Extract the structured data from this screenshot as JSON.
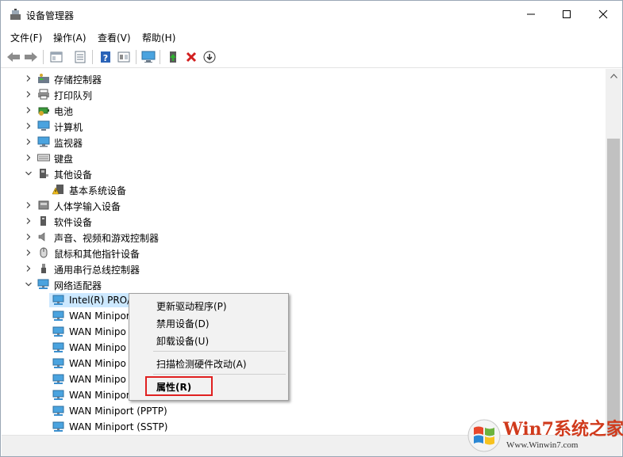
{
  "window": {
    "title": "设备管理器"
  },
  "menu": [
    "文件(F)",
    "操作(A)",
    "查看(V)",
    "帮助(H)"
  ],
  "toolbar": [
    "back-arrow-icon",
    "forward-arrow-icon",
    "properties-icon",
    "list-view-icon",
    "help-icon",
    "resources-icon",
    "monitor-scan-icon",
    "add-driver-icon",
    "delete-x-icon",
    "download-circle-icon"
  ],
  "tree": [
    {
      "label": "存储控制器",
      "indent": 0,
      "exp": "closed",
      "icon": "storage-controller-icon"
    },
    {
      "label": "打印队列",
      "indent": 0,
      "exp": "closed",
      "icon": "printer-icon"
    },
    {
      "label": "电池",
      "indent": 0,
      "exp": "closed",
      "icon": "battery-icon"
    },
    {
      "label": "计算机",
      "indent": 0,
      "exp": "closed",
      "icon": "computer-icon"
    },
    {
      "label": "监视器",
      "indent": 0,
      "exp": "closed",
      "icon": "monitor-icon"
    },
    {
      "label": "键盘",
      "indent": 0,
      "exp": "closed",
      "icon": "keyboard-icon"
    },
    {
      "label": "其他设备",
      "indent": 0,
      "exp": "open",
      "icon": "other-devices-icon"
    },
    {
      "label": "基本系统设备",
      "indent": 1,
      "exp": "none",
      "icon": "warning-device-icon"
    },
    {
      "label": "人体学输入设备",
      "indent": 0,
      "exp": "closed",
      "icon": "hid-icon"
    },
    {
      "label": "软件设备",
      "indent": 0,
      "exp": "closed",
      "icon": "software-device-icon"
    },
    {
      "label": "声音、视频和游戏控制器",
      "indent": 0,
      "exp": "closed",
      "icon": "speaker-icon"
    },
    {
      "label": "鼠标和其他指针设备",
      "indent": 0,
      "exp": "closed",
      "icon": "mouse-icon"
    },
    {
      "label": "通用串行总线控制器",
      "indent": 0,
      "exp": "closed",
      "icon": "usb-icon"
    },
    {
      "label": "网络适配器",
      "indent": 0,
      "exp": "open",
      "icon": "network-adapter-icon"
    },
    {
      "label": "Intel(R) PRO/",
      "indent": 1,
      "exp": "none",
      "icon": "network-adapter-icon",
      "selected": true
    },
    {
      "label": "WAN Minipor",
      "indent": 1,
      "exp": "none",
      "icon": "network-adapter-icon"
    },
    {
      "label": "WAN Minipo",
      "indent": 1,
      "exp": "none",
      "icon": "network-adapter-icon"
    },
    {
      "label": "WAN Minipo",
      "indent": 1,
      "exp": "none",
      "icon": "network-adapter-icon"
    },
    {
      "label": "WAN Minipo",
      "indent": 1,
      "exp": "none",
      "icon": "network-adapter-icon"
    },
    {
      "label": "WAN Minipo",
      "indent": 1,
      "exp": "none",
      "icon": "network-adapter-icon"
    },
    {
      "label": "WAN Miniport",
      "indent": 1,
      "exp": "none",
      "icon": "network-adapter-icon"
    },
    {
      "label": "WAN Miniport (PPTP)",
      "indent": 1,
      "exp": "none",
      "icon": "network-adapter-icon"
    },
    {
      "label": "WAN Miniport (SSTP)",
      "indent": 1,
      "exp": "none",
      "icon": "network-adapter-icon"
    }
  ],
  "context_menu": {
    "items": [
      {
        "label": "更新驱动程序(P)"
      },
      {
        "label": "禁用设备(D)"
      },
      {
        "label": "卸载设备(U)"
      },
      {
        "separator": true
      },
      {
        "label": "扫描检测硬件改动(A)"
      },
      {
        "separator": true
      },
      {
        "label": "属性(R)",
        "bold": true
      }
    ]
  },
  "watermark": {
    "brand": "Win7系统之家",
    "url": "Www.Winwin7.com"
  },
  "colors": {
    "selection": "#cce8ff",
    "highlight_box": "#e02020",
    "brand_red": "#d03a1c"
  }
}
